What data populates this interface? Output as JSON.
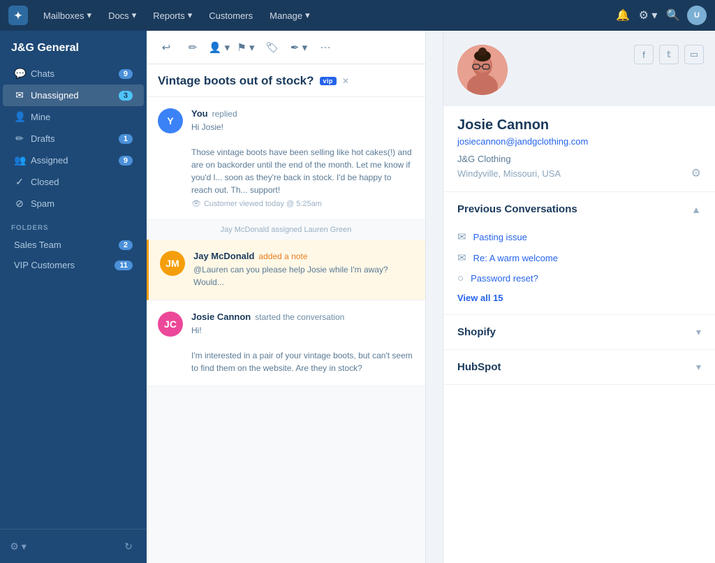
{
  "nav": {
    "logo": "✦",
    "items": [
      {
        "label": "Mailboxes",
        "hasArrow": true
      },
      {
        "label": "Docs",
        "hasArrow": true
      },
      {
        "label": "Reports",
        "hasArrow": true
      },
      {
        "label": "Customers",
        "hasArrow": false
      },
      {
        "label": "Manage",
        "hasArrow": true
      }
    ]
  },
  "sidebar": {
    "title": "J&G General",
    "items": [
      {
        "icon": "○",
        "label": "Chats",
        "badge": "9",
        "active": false
      },
      {
        "icon": "✉",
        "label": "Unassigned",
        "badge": "3",
        "active": true
      },
      {
        "icon": "○",
        "label": "Mine",
        "badge": "",
        "active": false
      },
      {
        "icon": "○",
        "label": "Drafts",
        "badge": "1",
        "active": false
      },
      {
        "icon": "○",
        "label": "Assigned",
        "badge": "9",
        "active": false
      },
      {
        "icon": "○",
        "label": "Closed",
        "badge": "",
        "active": false
      },
      {
        "icon": "○",
        "label": "Spam",
        "badge": "",
        "active": false
      }
    ],
    "folders_label": "FOLDERS",
    "folders": [
      {
        "label": "Sales Team",
        "badge": "2"
      },
      {
        "label": "VIP Customers",
        "badge": "11"
      }
    ]
  },
  "conversation": {
    "subject": "Vintage boots out of stock?",
    "vip_badge": "vip",
    "messages": [
      {
        "sender": "You",
        "action": "replied",
        "avatar_initials": "Y",
        "avatar_color": "av-blue",
        "text": "Hi Josie!\n\nThose vintage boots have been selling like hot cakes(!) and are on backorder until the end of the month. Let me know if you'd like to be notified as soon as they're back in stock. I'd be happy to reach out. Th... support!",
        "meta": "Customer viewed today @ 5:25am",
        "highlighted": false
      },
      {
        "divider": "Jay McDonald assigned Lauren Green"
      },
      {
        "sender": "Jay McDonald",
        "action": "added a note",
        "action_type": "note",
        "avatar_initials": "JM",
        "avatar_color": "av-orange",
        "text": "@Lauren can you please help Josie while I'm away? Would...",
        "highlighted": true
      },
      {
        "sender": "Josie Cannon",
        "action": "started the conversation",
        "avatar_initials": "JC",
        "avatar_color": "av-pink",
        "text": "Hi!\n\nI'm interested in a pair of your vintage boots, but can't seem to find them on the website. Are they in stock?",
        "highlighted": false
      }
    ]
  },
  "customer": {
    "name": "Josie Cannon",
    "email": "josiecannon@jandgclothing.com",
    "company": "J&G Clothing",
    "location": "Windyville, Missouri, USA",
    "social": [
      "f",
      "t",
      "▭"
    ],
    "previous_conversations": {
      "title": "Previous Conversations",
      "items": [
        {
          "icon": "✉",
          "text": "Pasting issue"
        },
        {
          "icon": "✉",
          "text": "Re: A warm welcome"
        },
        {
          "icon": "○",
          "text": "Password reset?"
        }
      ],
      "view_all": "View all 15"
    },
    "integrations": [
      {
        "title": "Shopify",
        "expanded": false
      },
      {
        "title": "HubSpot",
        "expanded": false
      }
    ]
  },
  "toolbar": {
    "buttons": [
      "↩",
      "✏",
      "👤",
      "⚑",
      "🏷",
      "✒",
      "..."
    ]
  }
}
